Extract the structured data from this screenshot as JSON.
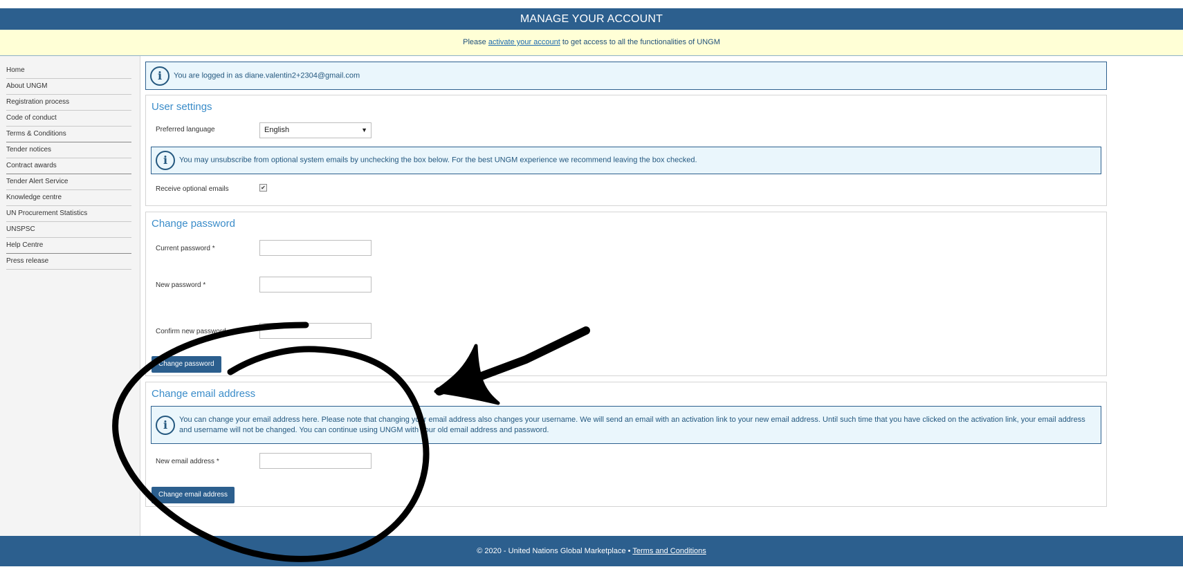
{
  "header": {
    "title": "MANAGE YOUR ACCOUNT"
  },
  "notice": {
    "prefix": "Please ",
    "link": "activate your account",
    "suffix": " to get access to all the functionalities of UNGM"
  },
  "sidebar": {
    "items": [
      {
        "label": "Home"
      },
      {
        "label": "About UNGM"
      },
      {
        "label": "Registration process"
      },
      {
        "label": "Code of conduct"
      },
      {
        "label": "Terms & Conditions"
      },
      {
        "label": "Tender notices"
      },
      {
        "label": "Contract awards"
      },
      {
        "label": "Tender Alert Service"
      },
      {
        "label": "Knowledge centre"
      },
      {
        "label": "UN Procurement Statistics"
      },
      {
        "label": "UNSPSC"
      },
      {
        "label": "Help Centre"
      },
      {
        "label": "Press release"
      }
    ]
  },
  "login_info": "You are logged in as diane.valentin2+2304@gmail.com",
  "user_settings": {
    "title": "User settings",
    "language_label": "Preferred language",
    "language_value": "English",
    "email_info": "You may unsubscribe from optional system emails by unchecking the box below. For the best UNGM experience we recommend leaving the box checked.",
    "optional_emails_label": "Receive optional emails",
    "optional_emails_checked": true
  },
  "change_password": {
    "title": "Change password",
    "current_label": "Current password *",
    "new_label": "New password *",
    "confirm_label": "Confirm new password",
    "button": "Change password"
  },
  "change_email": {
    "title": "Change email address",
    "info": "You can change your email address here. Please note that changing your email address also changes your username. We will send an email with an activation link to your new email address. Until such time that you have clicked on the activation link, your email address and username will not be changed. You can continue using UNGM with your old email address and password.",
    "new_email_label": "New email address *",
    "button": "Change email address"
  },
  "footer": {
    "copyright": "© 2020 - United Nations Global Marketplace • ",
    "terms_link": "Terms and Conditions"
  },
  "colors": {
    "brand_blue": "#2c5f8e",
    "notice_yellow": "#ffffd6",
    "heading_blue": "#3a8cc9",
    "info_bg": "#eaf6fc"
  }
}
